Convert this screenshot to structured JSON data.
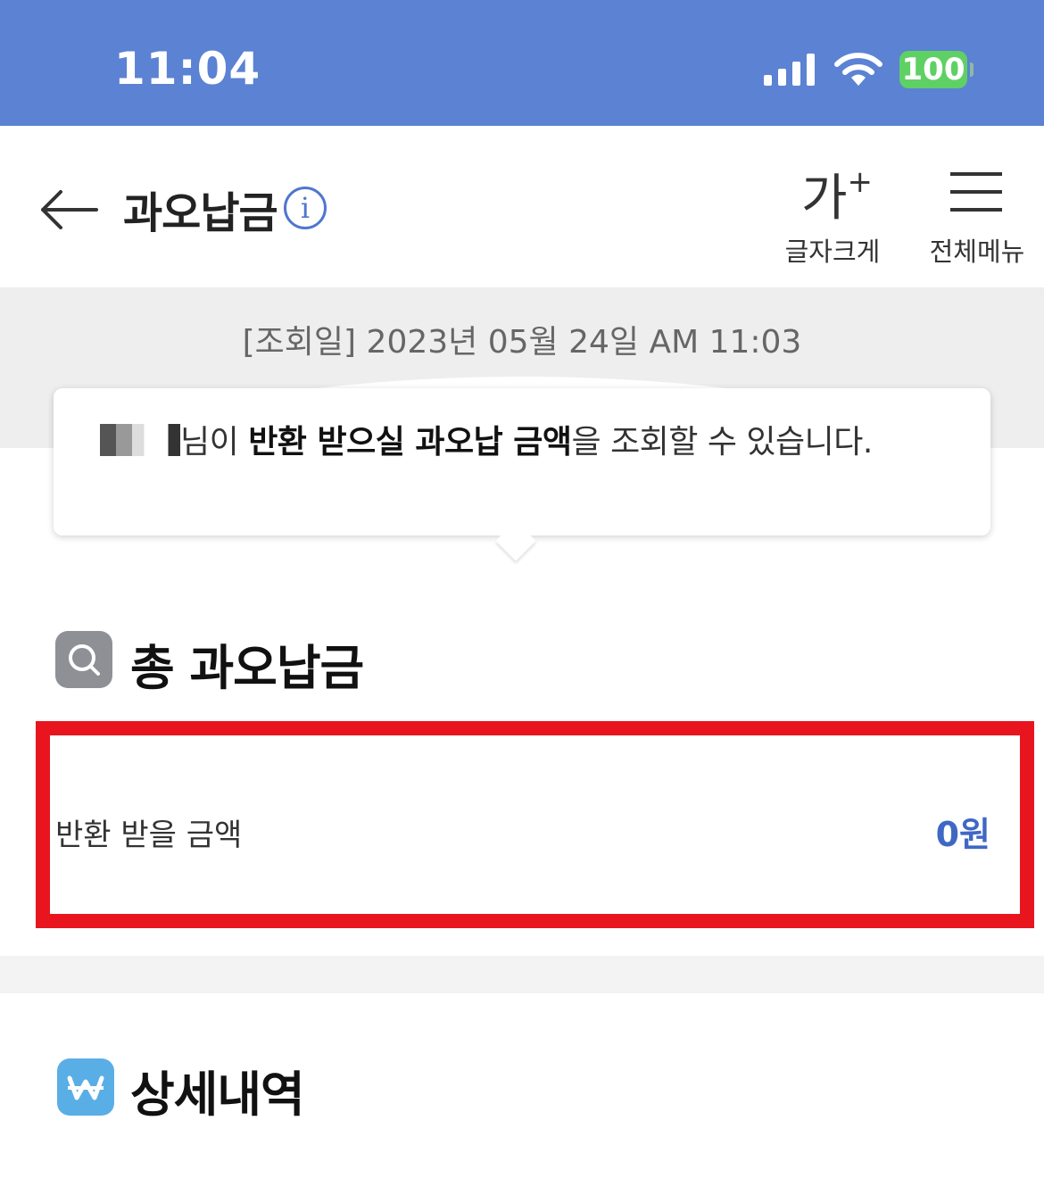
{
  "status_bar": {
    "time": "11:04",
    "battery": "100",
    "icons": [
      "signal-icon",
      "wifi-icon",
      "battery-icon"
    ]
  },
  "header": {
    "title": "과오납금",
    "font_size_glyph": "가",
    "font_size_plus": "+",
    "font_size_label": "글자크게",
    "menu_label": "전체메뉴",
    "info_glyph": "i"
  },
  "query_date": "[조회일] 2023년 05월 24일 AM 11:03",
  "notice": {
    "name_suffix": "님이 ",
    "emphasis": "반환 받으실 과오납 금액",
    "rest": "을 조회할 수 있습니다."
  },
  "total_section": {
    "title": "총 과오납금",
    "refund_label": "반환 받을 금액",
    "refund_value": "0원"
  },
  "detail_section": {
    "title": "상세내역"
  },
  "colors": {
    "status_bar": "#5b82d3",
    "accent": "#3f67c4",
    "highlight_box": "#e8151f",
    "battery": "#5fd064"
  }
}
